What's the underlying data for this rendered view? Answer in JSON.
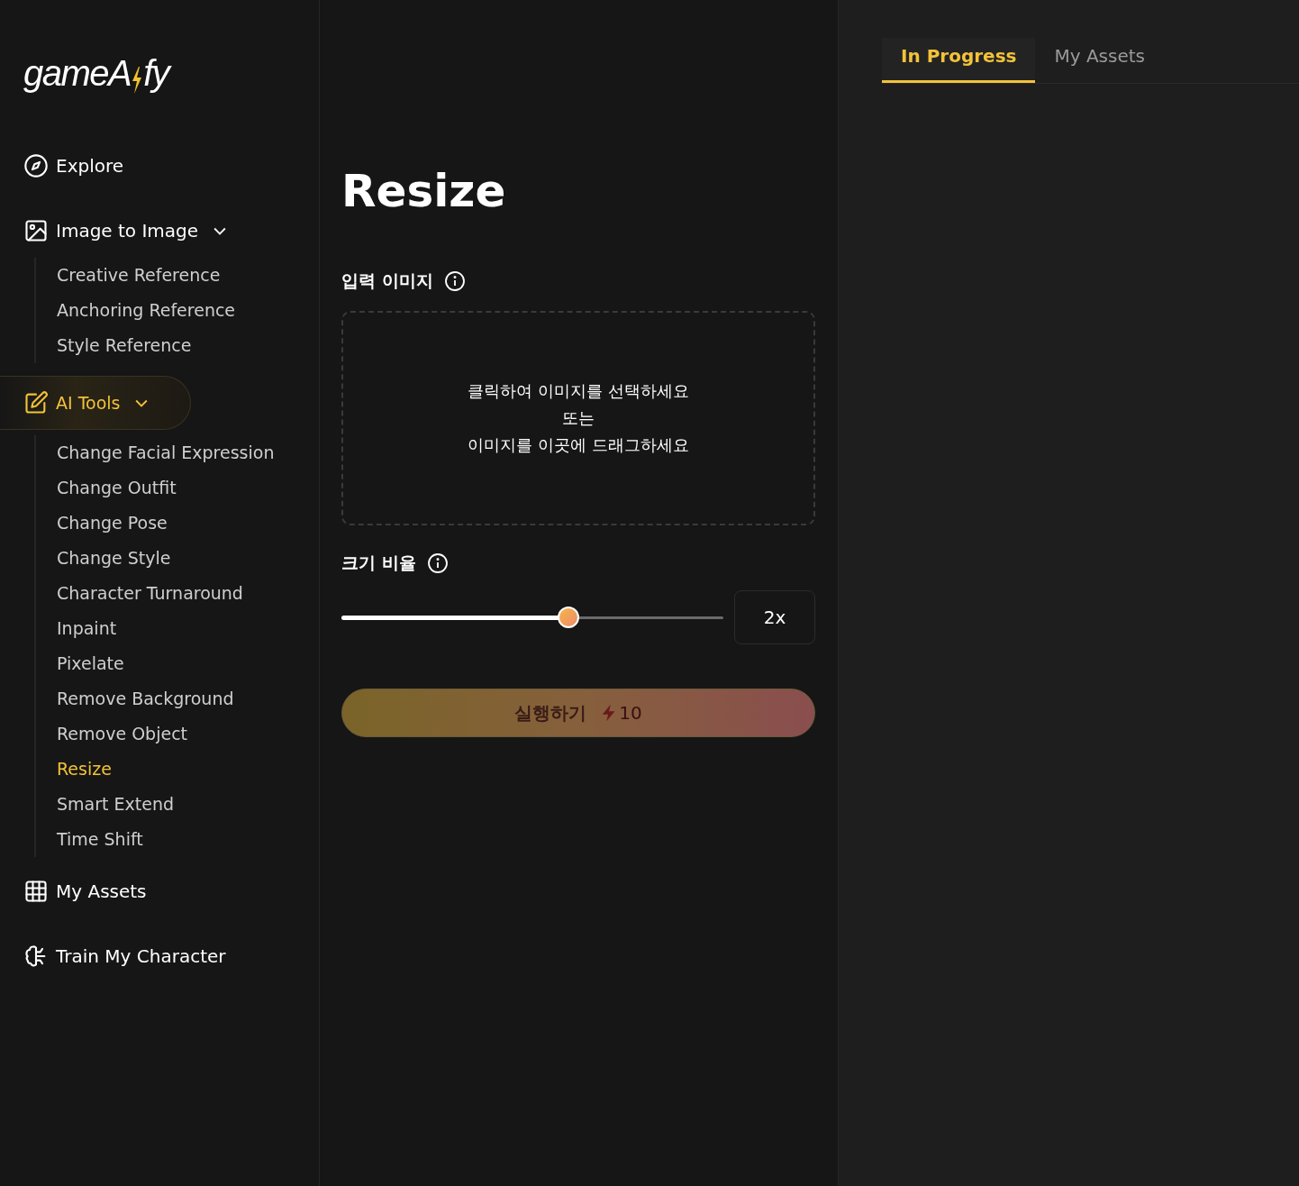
{
  "logo": {
    "text_before": "gameA",
    "text_after": "fy"
  },
  "sidebar": {
    "items": [
      {
        "kind": "link",
        "label": "Explore",
        "selected": false
      },
      {
        "kind": "group",
        "label": "Image to Image",
        "selected": false,
        "expanded": true,
        "children": [
          {
            "label": "Creative Reference",
            "selected": false
          },
          {
            "label": "Anchoring Reference",
            "selected": false
          },
          {
            "label": "Style Reference",
            "selected": false
          }
        ]
      },
      {
        "kind": "group",
        "label": "AI Tools",
        "selected": true,
        "expanded": true,
        "children": [
          {
            "label": "Change Facial Expression",
            "selected": false
          },
          {
            "label": "Change Outfit",
            "selected": false
          },
          {
            "label": "Change Pose",
            "selected": false
          },
          {
            "label": "Change Style",
            "selected": false
          },
          {
            "label": "Character Turnaround",
            "selected": false
          },
          {
            "label": "Inpaint",
            "selected": false
          },
          {
            "label": "Pixelate",
            "selected": false
          },
          {
            "label": "Remove Background",
            "selected": false
          },
          {
            "label": "Remove Object",
            "selected": false
          },
          {
            "label": "Resize",
            "selected": true
          },
          {
            "label": "Smart Extend",
            "selected": false
          },
          {
            "label": "Time Shift",
            "selected": false
          }
        ]
      },
      {
        "kind": "link",
        "label": "My Assets",
        "selected": false
      },
      {
        "kind": "link",
        "label": "Train My Character",
        "selected": false
      }
    ]
  },
  "main": {
    "title": "Resize",
    "input_image": {
      "label": "입력 이미지",
      "dropzone_lines": [
        "클릭하여 이미지를 선택하세요",
        "또는",
        "이미지를 이곳에 드래그하세요"
      ]
    },
    "scale": {
      "label": "크기 비율",
      "level": 0.595,
      "value": "2x"
    },
    "run_button": {
      "label": "실행하기",
      "cost": "10"
    }
  },
  "panel": {
    "tabs": [
      {
        "label": "In Progress",
        "selected": true
      },
      {
        "label": "My Assets",
        "selected": false
      }
    ]
  }
}
